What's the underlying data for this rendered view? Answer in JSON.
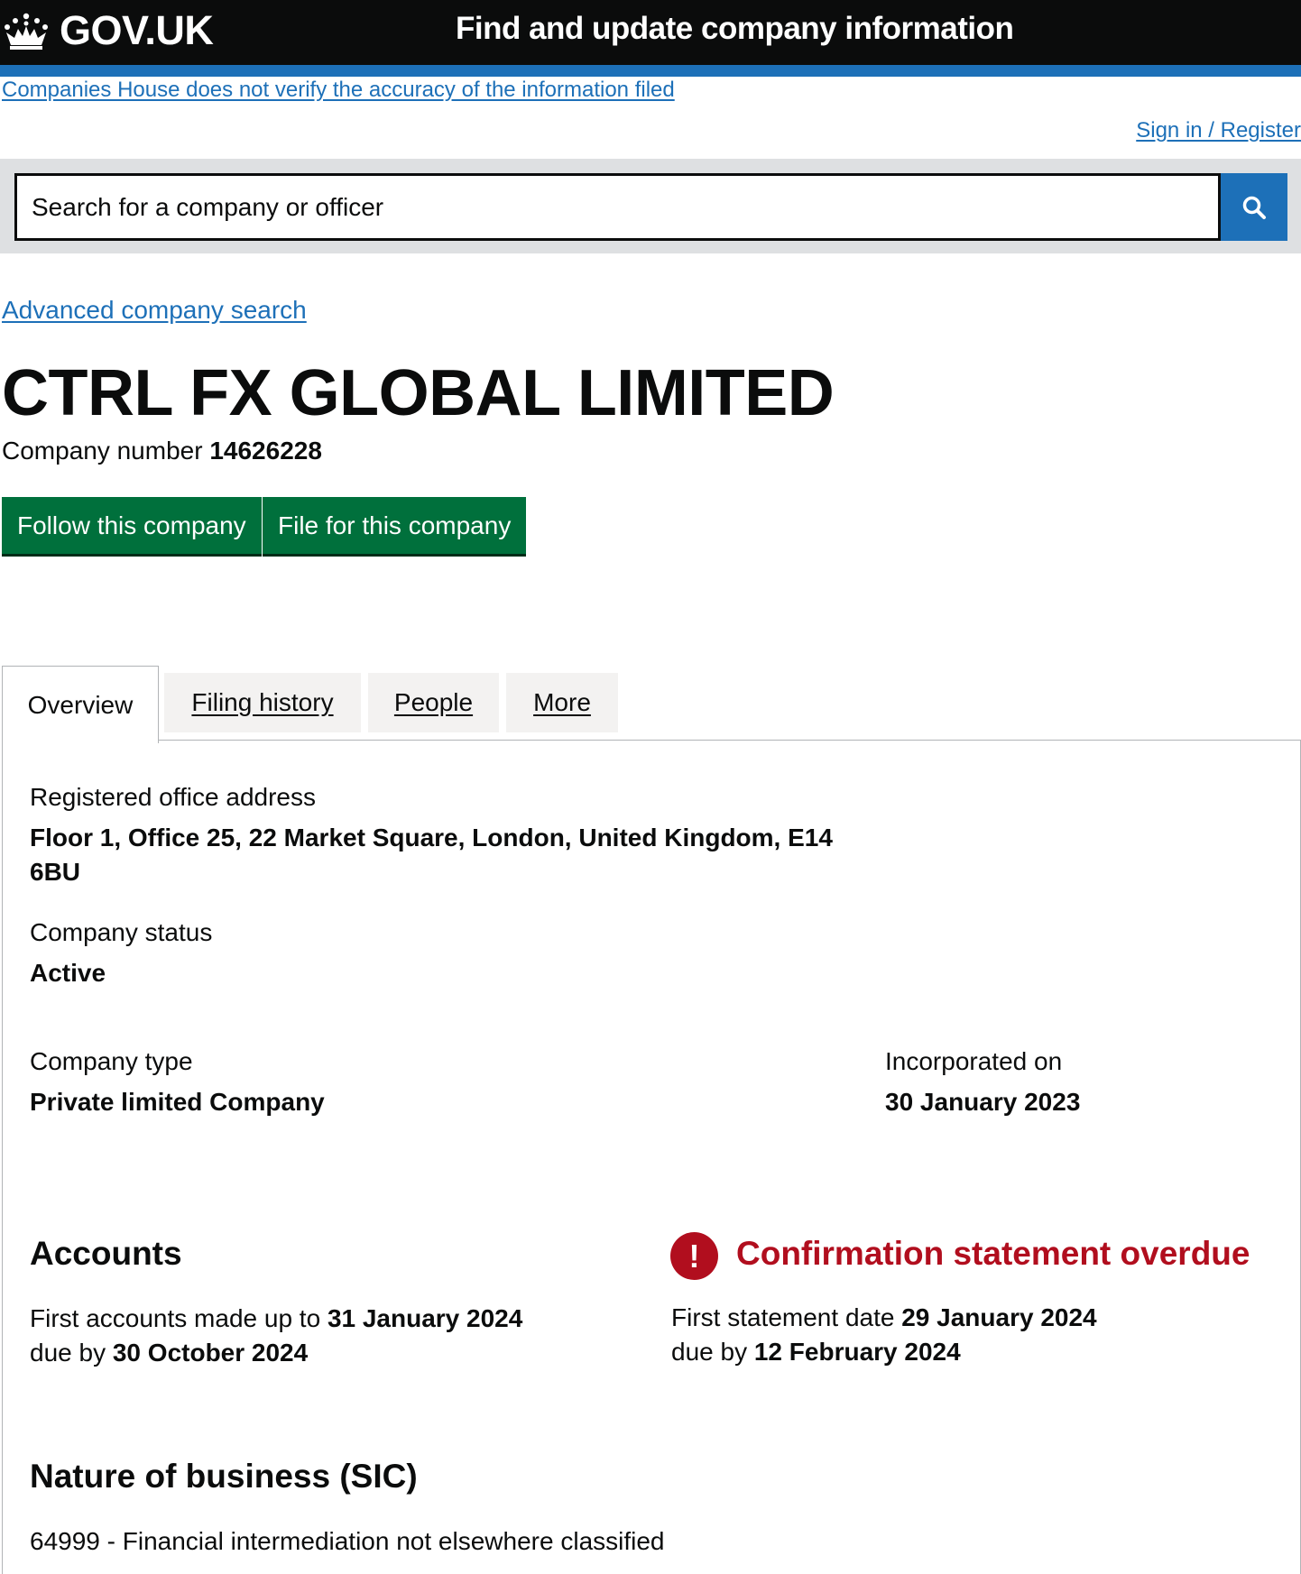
{
  "header": {
    "logo_text": "GOV.UK",
    "service_name": "Find and update company information",
    "colors": {
      "background": "#0b0c0c",
      "accent": "#1d70b8"
    }
  },
  "disclaimer_link": "Companies House does not verify the accuracy of the information filed",
  "signin_link": "Sign in / Register",
  "search": {
    "placeholder": "Search for a company or officer"
  },
  "advanced_search_link": "Advanced company search",
  "company": {
    "name": "CTRL FX GLOBAL LIMITED",
    "number_label": "Company number",
    "number": "14626228"
  },
  "actions": {
    "follow": "Follow this company",
    "file": "File for this company",
    "color": "#00703c"
  },
  "tabs": [
    {
      "label": "Overview",
      "active": true
    },
    {
      "label": "Filing history",
      "active": false
    },
    {
      "label": "People",
      "active": false
    },
    {
      "label": "More",
      "active": false
    }
  ],
  "overview": {
    "registered_office": {
      "label": "Registered office address",
      "line1": "Floor 1, Office 25, 22 Market Square, London, United Kingdom, E14",
      "line2": "6BU"
    },
    "status": {
      "label": "Company status",
      "value": "Active"
    },
    "type": {
      "label": "Company type",
      "value": "Private limited Company"
    },
    "incorporated": {
      "label": "Incorporated on",
      "value": "30 January 2023"
    },
    "accounts": {
      "heading": "Accounts",
      "first_prefix": "First accounts made up to",
      "first_date": "31 January 2024",
      "due_prefix": "due by",
      "due_date": "30 October 2024"
    },
    "confirmation": {
      "heading": "Confirmation statement overdue",
      "first_prefix": "First statement date",
      "first_date": "29 January 2024",
      "due_prefix": "due by",
      "due_date": "12 February 2024",
      "icon_glyph": "!",
      "color": "#b10e1e"
    },
    "sic": {
      "heading": "Nature of business (SIC)",
      "entry": "64999 - Financial intermediation not elsewhere classified"
    }
  }
}
